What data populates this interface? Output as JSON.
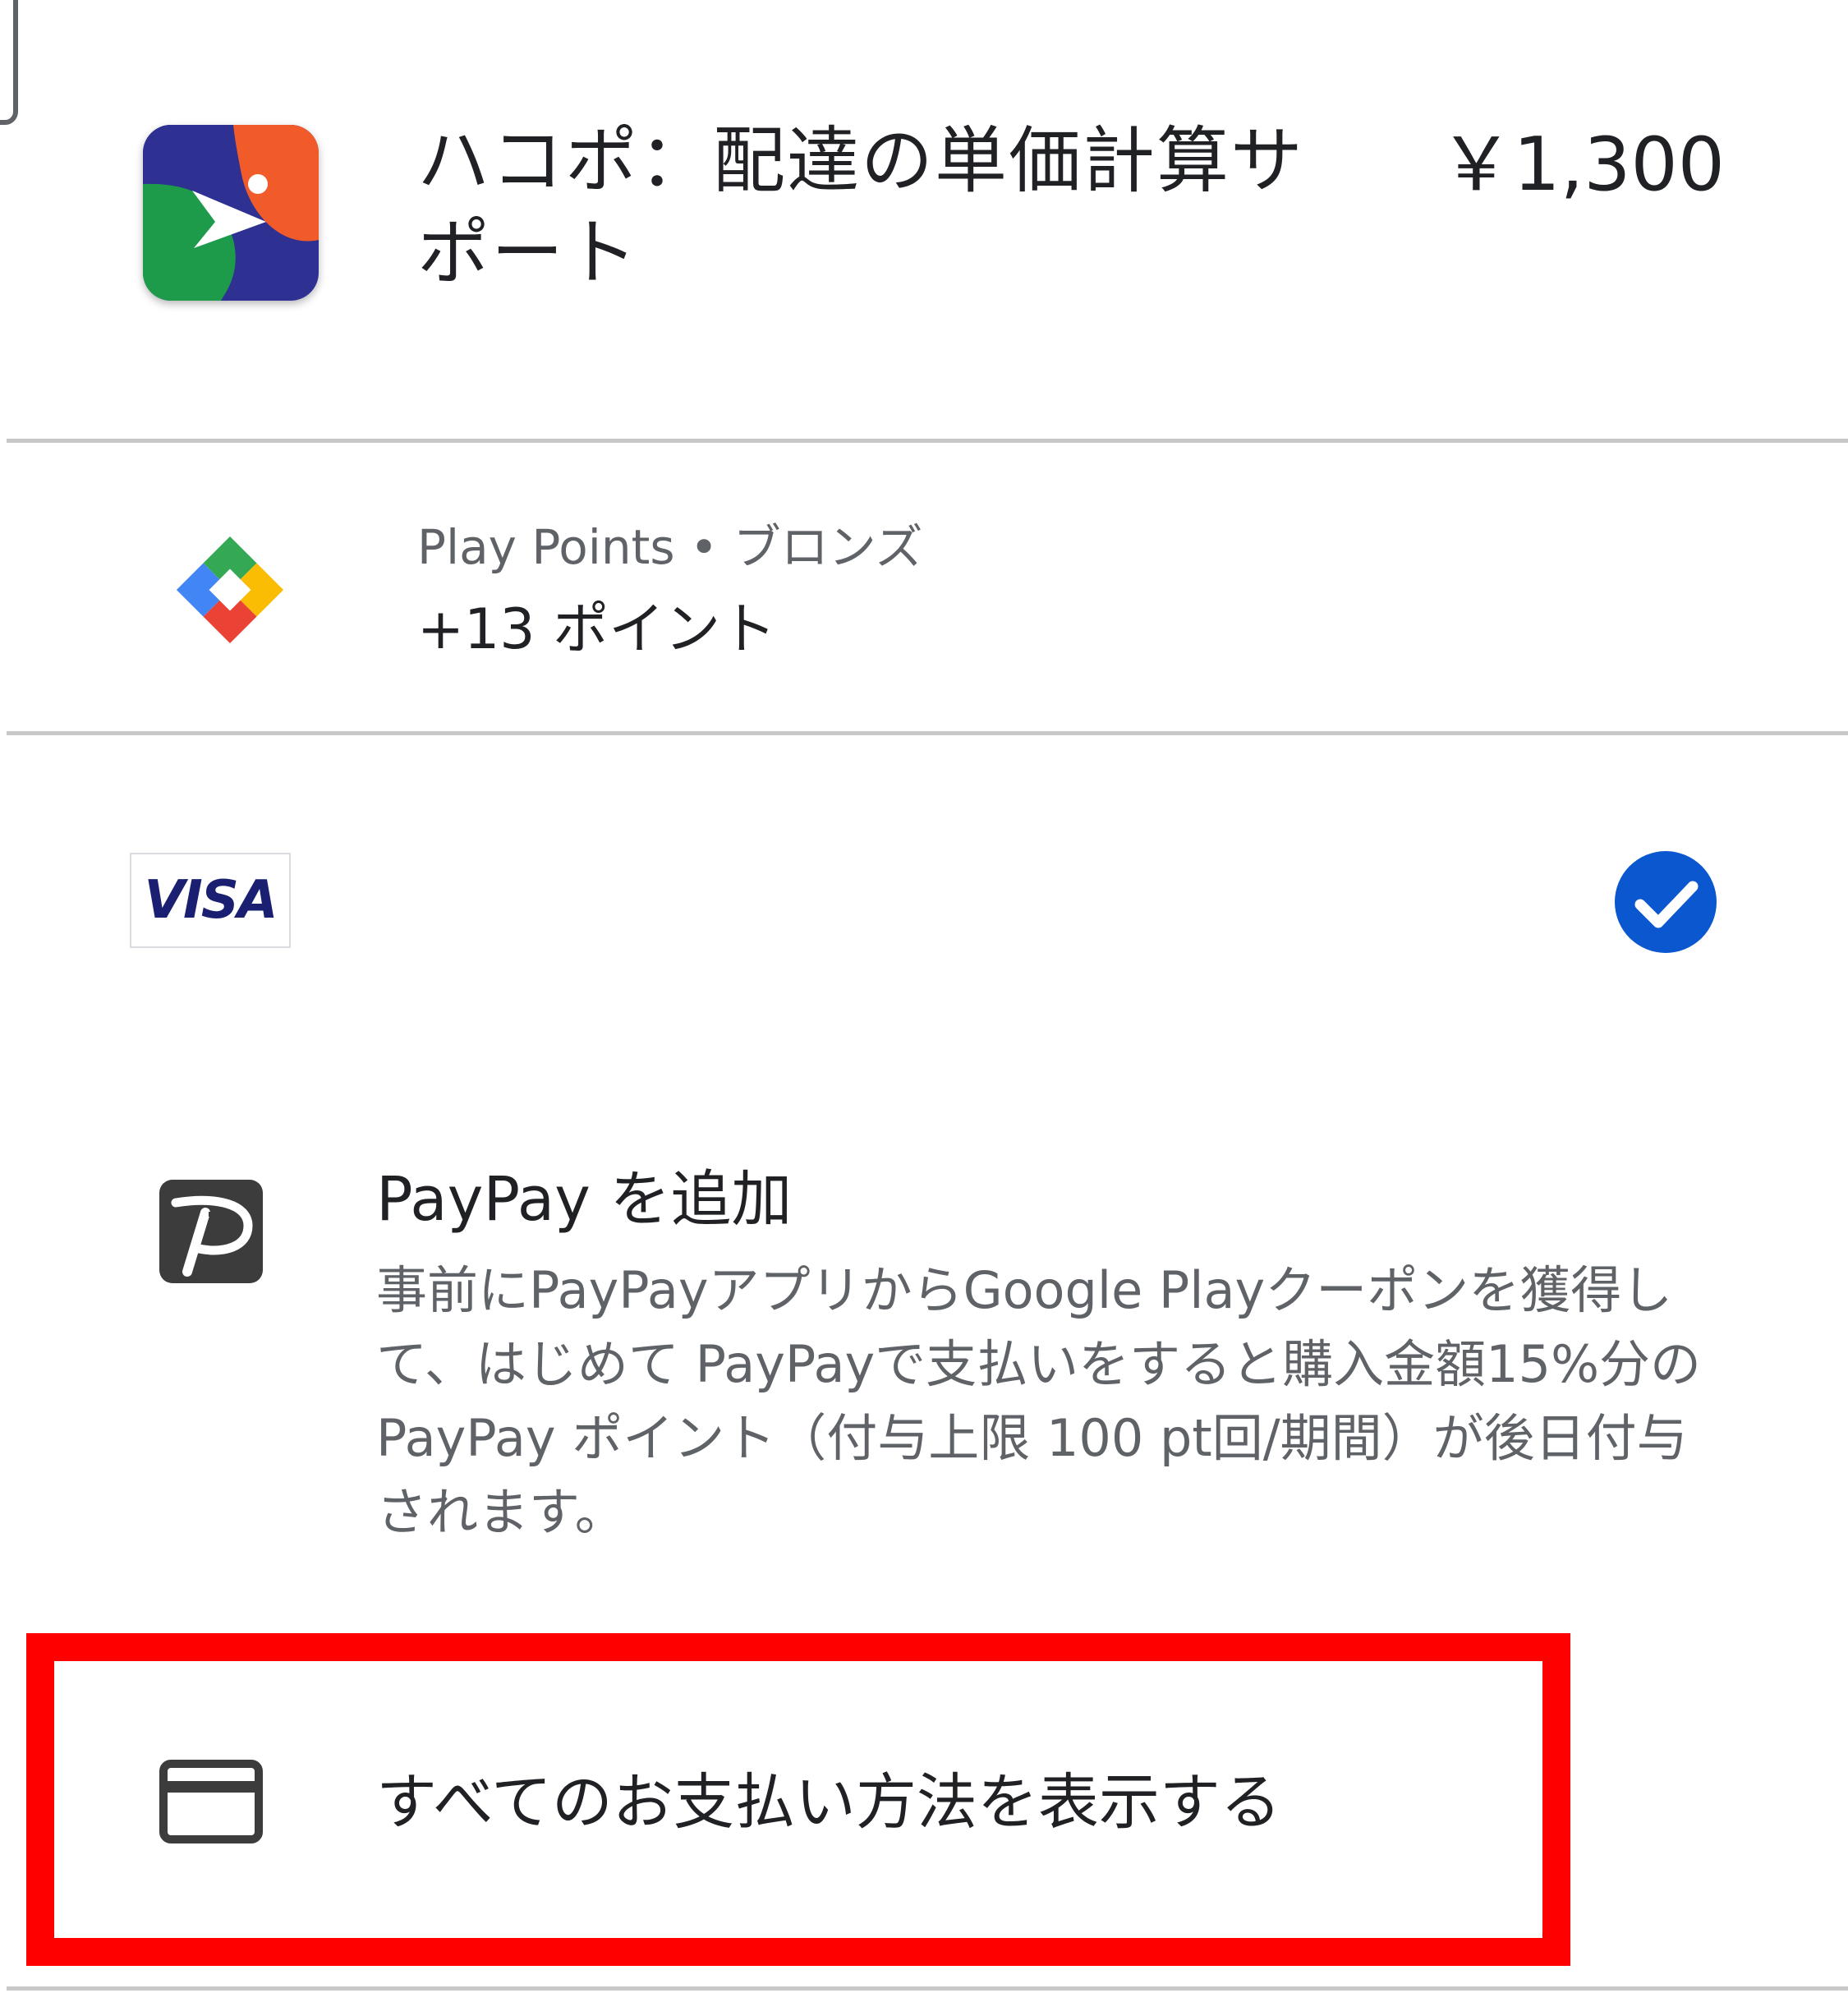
{
  "app": {
    "title": "ハコポ：配達の単価計算サポート",
    "price": "￥1,300",
    "icon": "hakopo-app-icon"
  },
  "play_points": {
    "tier_label": "Play Points • ブロンズ",
    "earned": "+13 ポイント",
    "icon": "play-points-icon"
  },
  "payment_methods": {
    "visa": {
      "brand": "VISA",
      "selected": true,
      "brand_color": "#1a1f71",
      "check_color": "#0b57d0"
    },
    "paypay": {
      "title": "PayPay を追加",
      "description": "事前にPayPayアプリからGoogle Playクーポンを獲得して、はじめて PayPayで支払いをすると購入金額15%分のPayPay ポイント（付与上限 100 pt回/期間）が後日付与されます。",
      "icon": "paypay-icon"
    },
    "show_all": {
      "label": "すべてのお支払い方法を表示する",
      "icon": "credit-card-icon"
    }
  },
  "annotation": {
    "highlight_color": "#ff0000"
  }
}
